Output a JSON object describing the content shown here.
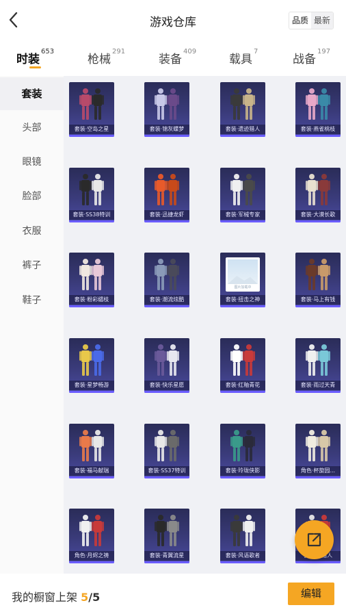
{
  "header": {
    "title": "游戏仓库",
    "back_icon": "chevron-left-icon",
    "sort_options": [
      "品质",
      "最新"
    ]
  },
  "tabs": [
    {
      "label": "时装",
      "count": "653",
      "active": true
    },
    {
      "label": "枪械",
      "count": "291"
    },
    {
      "label": "装备",
      "count": "409"
    },
    {
      "label": "载具",
      "count": "7"
    },
    {
      "label": "战备",
      "count": "197"
    }
  ],
  "sidebar": {
    "items": [
      {
        "label": "套装",
        "active": true
      },
      {
        "label": "头部"
      },
      {
        "label": "眼镜"
      },
      {
        "label": "脸部"
      },
      {
        "label": "衣服"
      },
      {
        "label": "裤子"
      },
      {
        "label": "鞋子"
      }
    ]
  },
  "grid": {
    "items": [
      {
        "label": "套装·空岛之星"
      },
      {
        "label": "套装·锦灰蝶梦"
      },
      {
        "label": "套装·遗迹猎人"
      },
      {
        "label": "套装·燕雀桃枝"
      },
      {
        "label": "套装·SS38特训"
      },
      {
        "label": "套装·迅捷龙虾"
      },
      {
        "label": "套装·军械专家"
      },
      {
        "label": "套装·大漠长歌"
      },
      {
        "label": "套装·粉彩缱枝"
      },
      {
        "label": "套装·潮流炫酷"
      },
      {
        "label": "套装·扭击之神",
        "placeholder": true,
        "placeholder_text": "图片加载中"
      },
      {
        "label": "套装·马上有钱"
      },
      {
        "label": "套装·星梦畅游"
      },
      {
        "label": "套装·快乐星愿"
      },
      {
        "label": "套装·红釉青花"
      },
      {
        "label": "套装·雨过天青"
      },
      {
        "label": "套装·福马献瑞"
      },
      {
        "label": "套装·SS37特训"
      },
      {
        "label": "套装·玲珑侠影"
      },
      {
        "label": "角色·杯旋园..."
      },
      {
        "label": "角色·月烬之祷"
      },
      {
        "label": "套装·青翼流星"
      },
      {
        "label": "套装·风语歌者"
      },
      {
        "label": "套装·...猎人"
      }
    ]
  },
  "fab": {
    "icon": "share-external-icon"
  },
  "footer": {
    "label": "我的橱窗上架",
    "current": "5",
    "separator": "/",
    "total": "5",
    "edit_label": "编辑"
  },
  "colors": {
    "accent": "#f5a623",
    "card_bg": "#3a3b7a",
    "sidebar_active_bg": "#f0f0f3"
  }
}
